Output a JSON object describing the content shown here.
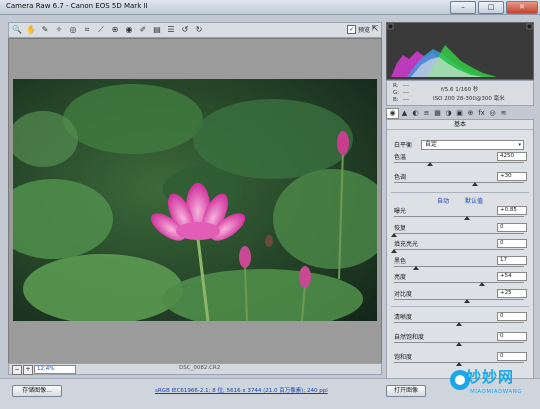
{
  "window": {
    "title": "Camera Raw 6.7 -  Canon EOS 5D Mark II",
    "minimize": "–",
    "maximize": "□",
    "close": "✕"
  },
  "toolbar": {
    "icons": [
      "zoom-icon",
      "hand-icon",
      "white-balance-icon",
      "color-sampler-icon",
      "target-adjust-icon",
      "crop-icon",
      "straighten-icon",
      "spot-removal-icon",
      "red-eye-icon",
      "adjust-brush-icon",
      "graduated-filter-icon",
      "preferences-icon",
      "rotate-left-icon",
      "rotate-right-icon"
    ],
    "glyphs": [
      "🔍",
      "✋",
      "✎",
      "✧",
      "◎",
      "⌗",
      "⟋",
      "⊕",
      "◉",
      "✐",
      "▤",
      "☰",
      "↺",
      "↻"
    ],
    "preview_label": "预览",
    "preview_checked": "✓",
    "fullscreen_glyph": "⇱"
  },
  "status": {
    "zoom_minus": "−",
    "zoom_plus": "+",
    "zoom_value": "12.4%",
    "filename": "DSC_0082.CR2"
  },
  "bottom": {
    "save_button": "存储图像...",
    "workflow_link": "sRGB IEC61966-2.1; 8 位; 5616 x 3744 (21.0 百万像素); 240 ppi",
    "open_button": "打开图像"
  },
  "readouts": {
    "r_label": "R:",
    "g_label": "G:",
    "b_label": "B:",
    "r_value": "---",
    "g_value": "---",
    "b_value": "---",
    "exposure_line1": "f/5.6   1/160 秒",
    "exposure_line2": "ISO 200   28-300@300 毫米"
  },
  "tabs": {
    "glyphs": [
      "◉",
      "▲",
      "◐",
      "≡",
      "▦",
      "◑",
      "▣",
      "⊕",
      "fx",
      "◎",
      "≋"
    ]
  },
  "panel": {
    "title": "基本",
    "wb_label": "白平衡",
    "wb_value": "自定",
    "wb_arrow": "▾",
    "auto_link": "自动",
    "default_link": "默认值",
    "sliders": [
      {
        "label": "色温",
        "value": "4250",
        "position": 0.28
      },
      {
        "label": "色调",
        "value": "+30",
        "position": 0.62
      },
      {
        "label": "曝光",
        "value": "+0.85",
        "position": 0.56
      },
      {
        "label": "恢复",
        "value": "0",
        "position": 0.0
      },
      {
        "label": "填充亮光",
        "value": "0",
        "position": 0.0
      },
      {
        "label": "黑色",
        "value": "17",
        "position": 0.17
      },
      {
        "label": "亮度",
        "value": "+54",
        "position": 0.68
      },
      {
        "label": "对比度",
        "value": "+25",
        "position": 0.56
      },
      {
        "label": "清晰度",
        "value": "0",
        "position": 0.5
      },
      {
        "label": "自然饱和度",
        "value": "0",
        "position": 0.5
      },
      {
        "label": "饱和度",
        "value": "0",
        "position": 0.5
      }
    ]
  },
  "watermark": {
    "text": "妙妙网",
    "sub": "MIAOMIAOWANG"
  }
}
